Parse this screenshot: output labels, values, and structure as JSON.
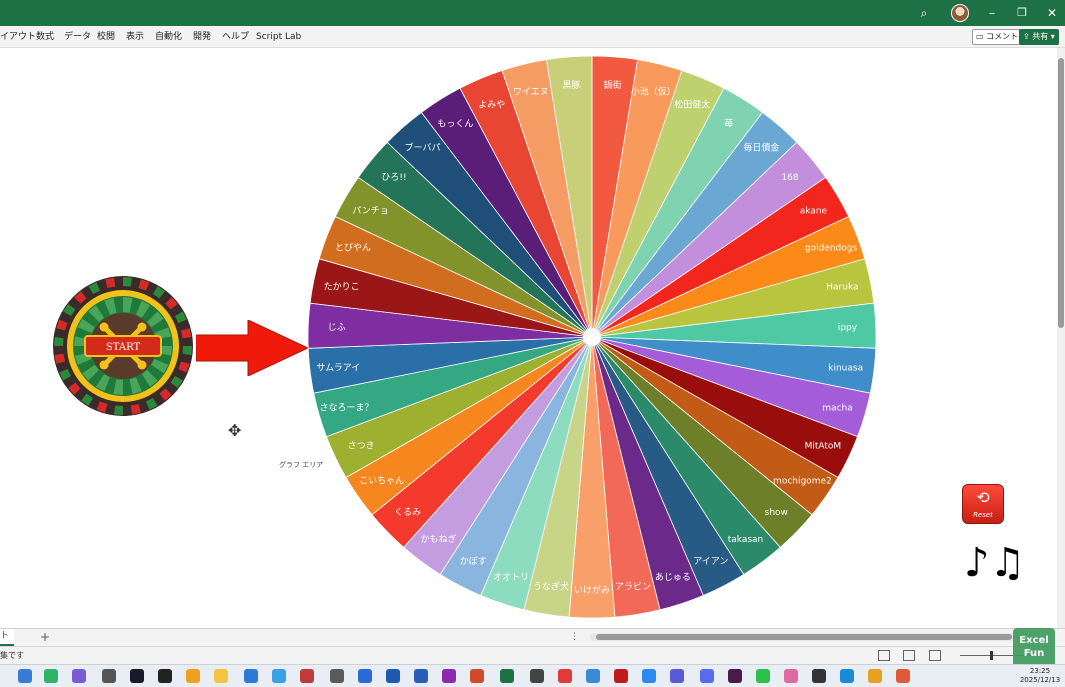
{
  "ribbon": {
    "tabs": [
      "イアウト",
      "数式",
      "データ",
      "校閲",
      "表示",
      "自動化",
      "開発",
      "ヘルプ",
      "Script Lab"
    ],
    "comment_label": "コメント",
    "share_label": "共有"
  },
  "wheel": {
    "labels": [
      "鍋街",
      "小池（仮）",
      "松田健太",
      "苺",
      "毎日債金",
      "168",
      "akane",
      "goldendogs",
      "Haruka",
      "ippy",
      "kinuasa",
      "macha",
      "MitAtoM",
      "mochigome2",
      "show",
      "takasan",
      "アイアン",
      "あじゅる",
      "アラビン",
      "いけがみ",
      "うなぎ犬",
      "オオトリ",
      "かぼす",
      "かもねぎ",
      "くるみ",
      "こいちゃん",
      "さつき",
      "さなろーま？",
      "サムラアイ",
      "じふ",
      "たかりこ",
      "とびやん",
      "パンチョ",
      "ひろ!!",
      "ブーバパ",
      "もっくん",
      "よみや",
      "ワイエヌ",
      "黒豚"
    ],
    "colors": [
      "#f15a40",
      "#f79a5b",
      "#bfd06f",
      "#7fd3b0",
      "#6aa7d3",
      "#c38fdc",
      "#f2261c",
      "#fb8a19",
      "#b9c53e",
      "#4fc9a4",
      "#3f8dc9",
      "#a45cd9",
      "#9a0d0d",
      "#c25b16",
      "#6d7f28",
      "#2b8a6a",
      "#285a86",
      "#6b2a8a",
      "#f26a57",
      "#f9a06a",
      "#c8d589",
      "#8edcc0",
      "#89b5de",
      "#c49de0",
      "#f43a2c",
      "#f6871e",
      "#9db02f",
      "#34a882",
      "#2a6fa8",
      "#7e2ea0",
      "#9b1616",
      "#d16d1e",
      "#83932c",
      "#24745a",
      "#1f4f78",
      "#5a1e78",
      "#e84532",
      "#f59b64",
      "#c7cf78"
    ]
  },
  "start_button": {
    "label": "START"
  },
  "chart_area_label": "グラフ エリア",
  "reset_button": {
    "label": "Reset",
    "icon": "refresh-icon"
  },
  "music_icon": "music-notes-icon",
  "sheet": {
    "tab_label": "ト",
    "add_label": "+",
    "dots": "⋮"
  },
  "status": {
    "text": "集です",
    "zoom": "%"
  },
  "badge": {
    "line1": "Excel",
    "line2": "Fun"
  },
  "clock": {
    "time": "23:25",
    "date": "2025/12/13"
  }
}
